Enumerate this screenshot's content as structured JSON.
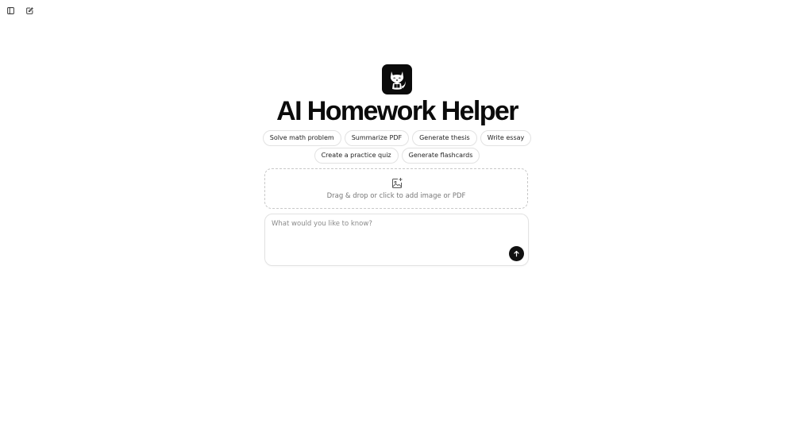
{
  "app": {
    "title": "AI Homework Helper",
    "brand_color": "#0b0b0b"
  },
  "toolbar": {
    "sidebar_toggle_icon": "sidebar-panel-icon",
    "new_chat_icon": "edit-square-icon"
  },
  "logo": {
    "icon": "cartoon-fox-with-book-icon"
  },
  "suggestions": {
    "row1": [
      "Solve math problem",
      "Summarize PDF",
      "Generate thesis",
      "Write essay"
    ],
    "row2": [
      "Create a practice quiz",
      "Generate flashcards"
    ]
  },
  "upload": {
    "icon": "image-add-icon",
    "text": "Drag & drop or click to add image or PDF"
  },
  "composer": {
    "placeholder": "What would you like to know?",
    "value": "",
    "send_icon": "arrow-up-icon"
  }
}
